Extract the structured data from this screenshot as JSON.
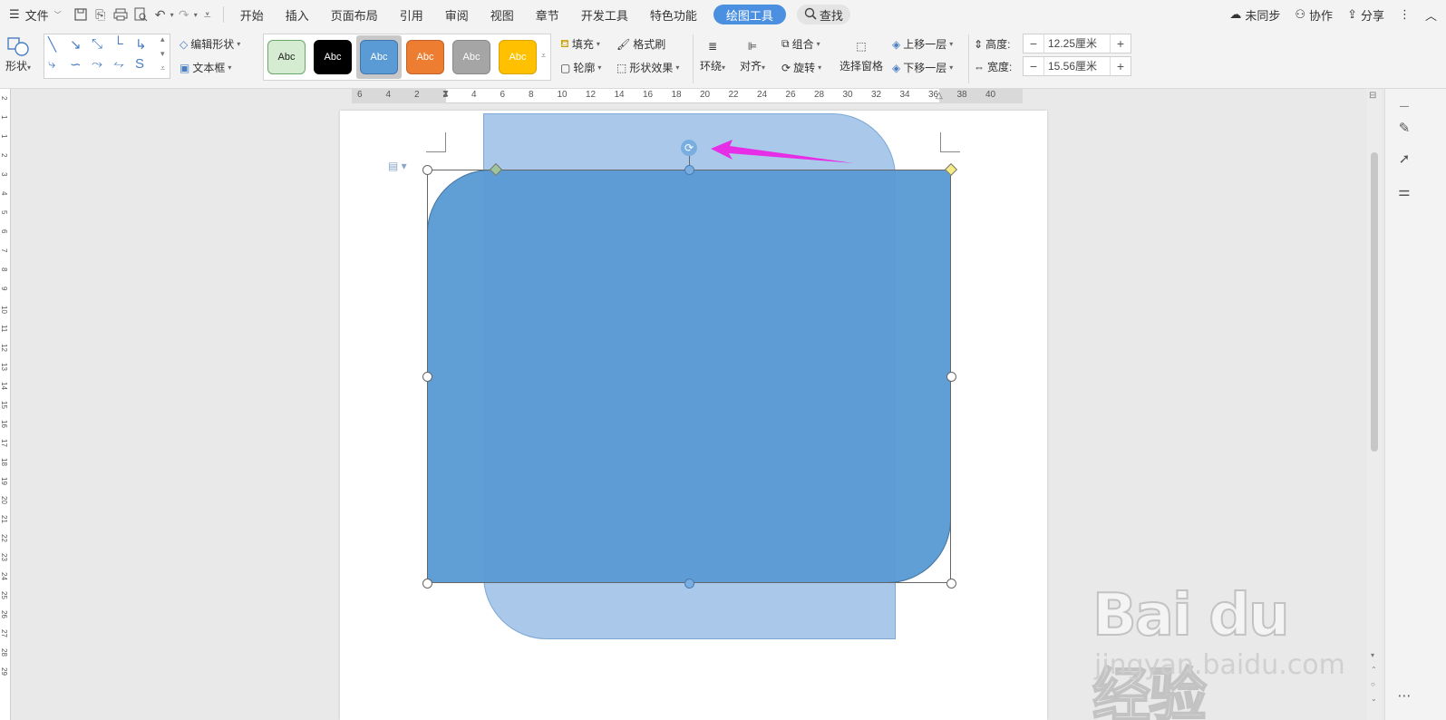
{
  "menubar": {
    "file_label": "文件",
    "tabs": [
      "开始",
      "插入",
      "页面布局",
      "引用",
      "审阅",
      "视图",
      "章节",
      "开发工具",
      "特色功能"
    ],
    "active_tab": "绘图工具",
    "search_label": "查找",
    "unsync_label": "未同步",
    "collab_label": "协作",
    "share_label": "分享"
  },
  "ribbon": {
    "shape_label": "形状",
    "edit_shape_label": "编辑形状",
    "textbox_label": "文本框",
    "styles": [
      {
        "label": "Abc",
        "bg": "#d6ecd2",
        "fg": "#222222",
        "border": "#6aa86a"
      },
      {
        "label": "Abc",
        "bg": "#000000",
        "fg": "#ffffff",
        "border": "#000000"
      },
      {
        "label": "Abc",
        "bg": "#5b9bd5",
        "fg": "#ffffff",
        "border": "#3f76ad"
      },
      {
        "label": "Abc",
        "bg": "#ed7d31",
        "fg": "#ffffff",
        "border": "#c0622a"
      },
      {
        "label": "Abc",
        "bg": "#a5a5a5",
        "fg": "#ffffff",
        "border": "#888888"
      },
      {
        "label": "Abc",
        "bg": "#ffc000",
        "fg": "#ffffff",
        "border": "#d9a400"
      }
    ],
    "fill_label": "填充",
    "format_painter_label": "格式刷",
    "outline_label": "轮廓",
    "shape_effects_label": "形状效果",
    "wrap_label": "环绕",
    "align_label": "对齐",
    "group_label": "组合",
    "rotate_label": "旋转",
    "selection_pane_label": "选择窗格",
    "bring_forward_label": "上移一层",
    "send_backward_label": "下移一层",
    "height_label": "高度:",
    "height_value": "12.25厘米",
    "width_label": "宽度:",
    "width_value": "15.56厘米"
  },
  "ruler": {
    "h_ticks": [
      "6",
      "4",
      "2",
      "2",
      "4",
      "6",
      "8",
      "10",
      "12",
      "14",
      "16",
      "18",
      "20",
      "22",
      "24",
      "26",
      "28",
      "30",
      "32",
      "34",
      "36",
      "38",
      "40"
    ],
    "v_ticks": [
      "2",
      "1",
      "1",
      "2",
      "3",
      "4",
      "5",
      "6",
      "7",
      "8",
      "9",
      "10",
      "11",
      "12",
      "13",
      "14",
      "15",
      "16",
      "17",
      "18",
      "19",
      "20",
      "21",
      "22",
      "23",
      "24",
      "25",
      "26",
      "27",
      "28",
      "29"
    ]
  },
  "watermark": {
    "main": "Bai du 经验",
    "sub": "jingyan.baidu.com"
  },
  "colors": {
    "accent": "#4a8fe0",
    "shape_front": "#5b9bd5",
    "shape_back": "#aac9ea",
    "arrow": "#e62ee6"
  }
}
